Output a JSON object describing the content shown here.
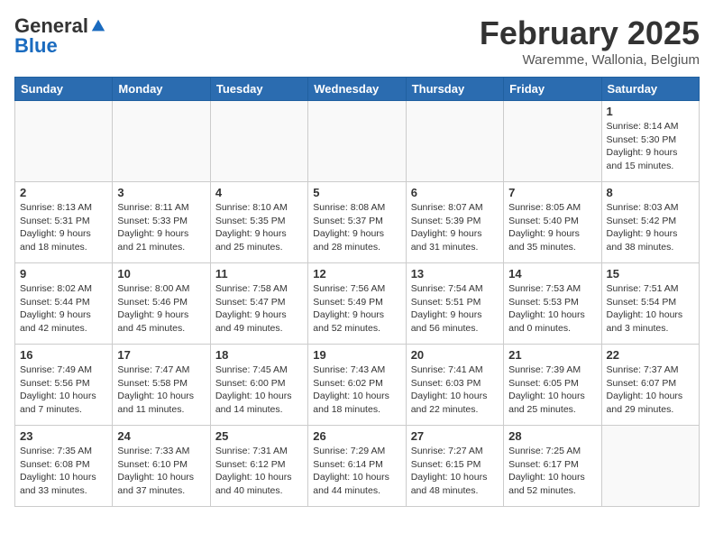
{
  "header": {
    "logo_general": "General",
    "logo_blue": "Blue",
    "month_title": "February 2025",
    "subtitle": "Waremme, Wallonia, Belgium"
  },
  "days_of_week": [
    "Sunday",
    "Monday",
    "Tuesday",
    "Wednesday",
    "Thursday",
    "Friday",
    "Saturday"
  ],
  "weeks": [
    [
      {
        "day": "",
        "info": ""
      },
      {
        "day": "",
        "info": ""
      },
      {
        "day": "",
        "info": ""
      },
      {
        "day": "",
        "info": ""
      },
      {
        "day": "",
        "info": ""
      },
      {
        "day": "",
        "info": ""
      },
      {
        "day": "1",
        "info": "Sunrise: 8:14 AM\nSunset: 5:30 PM\nDaylight: 9 hours and 15 minutes."
      }
    ],
    [
      {
        "day": "2",
        "info": "Sunrise: 8:13 AM\nSunset: 5:31 PM\nDaylight: 9 hours and 18 minutes."
      },
      {
        "day": "3",
        "info": "Sunrise: 8:11 AM\nSunset: 5:33 PM\nDaylight: 9 hours and 21 minutes."
      },
      {
        "day": "4",
        "info": "Sunrise: 8:10 AM\nSunset: 5:35 PM\nDaylight: 9 hours and 25 minutes."
      },
      {
        "day": "5",
        "info": "Sunrise: 8:08 AM\nSunset: 5:37 PM\nDaylight: 9 hours and 28 minutes."
      },
      {
        "day": "6",
        "info": "Sunrise: 8:07 AM\nSunset: 5:39 PM\nDaylight: 9 hours and 31 minutes."
      },
      {
        "day": "7",
        "info": "Sunrise: 8:05 AM\nSunset: 5:40 PM\nDaylight: 9 hours and 35 minutes."
      },
      {
        "day": "8",
        "info": "Sunrise: 8:03 AM\nSunset: 5:42 PM\nDaylight: 9 hours and 38 minutes."
      }
    ],
    [
      {
        "day": "9",
        "info": "Sunrise: 8:02 AM\nSunset: 5:44 PM\nDaylight: 9 hours and 42 minutes."
      },
      {
        "day": "10",
        "info": "Sunrise: 8:00 AM\nSunset: 5:46 PM\nDaylight: 9 hours and 45 minutes."
      },
      {
        "day": "11",
        "info": "Sunrise: 7:58 AM\nSunset: 5:47 PM\nDaylight: 9 hours and 49 minutes."
      },
      {
        "day": "12",
        "info": "Sunrise: 7:56 AM\nSunset: 5:49 PM\nDaylight: 9 hours and 52 minutes."
      },
      {
        "day": "13",
        "info": "Sunrise: 7:54 AM\nSunset: 5:51 PM\nDaylight: 9 hours and 56 minutes."
      },
      {
        "day": "14",
        "info": "Sunrise: 7:53 AM\nSunset: 5:53 PM\nDaylight: 10 hours and 0 minutes."
      },
      {
        "day": "15",
        "info": "Sunrise: 7:51 AM\nSunset: 5:54 PM\nDaylight: 10 hours and 3 minutes."
      }
    ],
    [
      {
        "day": "16",
        "info": "Sunrise: 7:49 AM\nSunset: 5:56 PM\nDaylight: 10 hours and 7 minutes."
      },
      {
        "day": "17",
        "info": "Sunrise: 7:47 AM\nSunset: 5:58 PM\nDaylight: 10 hours and 11 minutes."
      },
      {
        "day": "18",
        "info": "Sunrise: 7:45 AM\nSunset: 6:00 PM\nDaylight: 10 hours and 14 minutes."
      },
      {
        "day": "19",
        "info": "Sunrise: 7:43 AM\nSunset: 6:02 PM\nDaylight: 10 hours and 18 minutes."
      },
      {
        "day": "20",
        "info": "Sunrise: 7:41 AM\nSunset: 6:03 PM\nDaylight: 10 hours and 22 minutes."
      },
      {
        "day": "21",
        "info": "Sunrise: 7:39 AM\nSunset: 6:05 PM\nDaylight: 10 hours and 25 minutes."
      },
      {
        "day": "22",
        "info": "Sunrise: 7:37 AM\nSunset: 6:07 PM\nDaylight: 10 hours and 29 minutes."
      }
    ],
    [
      {
        "day": "23",
        "info": "Sunrise: 7:35 AM\nSunset: 6:08 PM\nDaylight: 10 hours and 33 minutes."
      },
      {
        "day": "24",
        "info": "Sunrise: 7:33 AM\nSunset: 6:10 PM\nDaylight: 10 hours and 37 minutes."
      },
      {
        "day": "25",
        "info": "Sunrise: 7:31 AM\nSunset: 6:12 PM\nDaylight: 10 hours and 40 minutes."
      },
      {
        "day": "26",
        "info": "Sunrise: 7:29 AM\nSunset: 6:14 PM\nDaylight: 10 hours and 44 minutes."
      },
      {
        "day": "27",
        "info": "Sunrise: 7:27 AM\nSunset: 6:15 PM\nDaylight: 10 hours and 48 minutes."
      },
      {
        "day": "28",
        "info": "Sunrise: 7:25 AM\nSunset: 6:17 PM\nDaylight: 10 hours and 52 minutes."
      },
      {
        "day": "",
        "info": ""
      }
    ]
  ]
}
